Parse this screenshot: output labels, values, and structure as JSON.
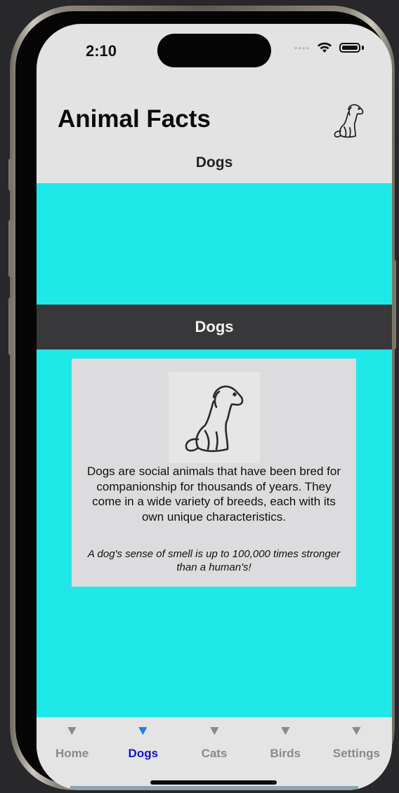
{
  "status_bar": {
    "time": "2:10",
    "signal_dots": "••••",
    "wifi_icon": "wifi-icon",
    "battery_icon": "battery-icon"
  },
  "header": {
    "title": "Animal Facts",
    "icon": "dog-outline-icon",
    "subtitle": "Dogs"
  },
  "section": {
    "header": "Dogs"
  },
  "card": {
    "image_icon": "dog-outline-icon",
    "description": "Dogs are social animals that have been bred for companionship for thousands of years. They come in a wide variety of breeds, each with its own unique characteristics.",
    "fact": "A dog's sense of smell is up to 100,000 times stronger than a human's!"
  },
  "tab_bar": {
    "tabs": [
      {
        "label": "Home",
        "icon": "triangle-down-icon",
        "active": false
      },
      {
        "label": "Dogs",
        "icon": "triangle-down-icon",
        "active": true
      },
      {
        "label": "Cats",
        "icon": "triangle-down-icon",
        "active": false
      },
      {
        "label": "Birds",
        "icon": "triangle-down-icon",
        "active": false
      },
      {
        "label": "Settings",
        "icon": "triangle-down-icon",
        "active": false
      }
    ],
    "icon_glyph": "▼"
  },
  "colors": {
    "background_cyan": "#1fe8e8",
    "section_header_bg": "#38383a",
    "card_bg": "#dcdbdd",
    "tab_active_label": "#1515c8",
    "tab_active_icon": "#1a7ff0",
    "tab_inactive": "#8a8a8a"
  }
}
